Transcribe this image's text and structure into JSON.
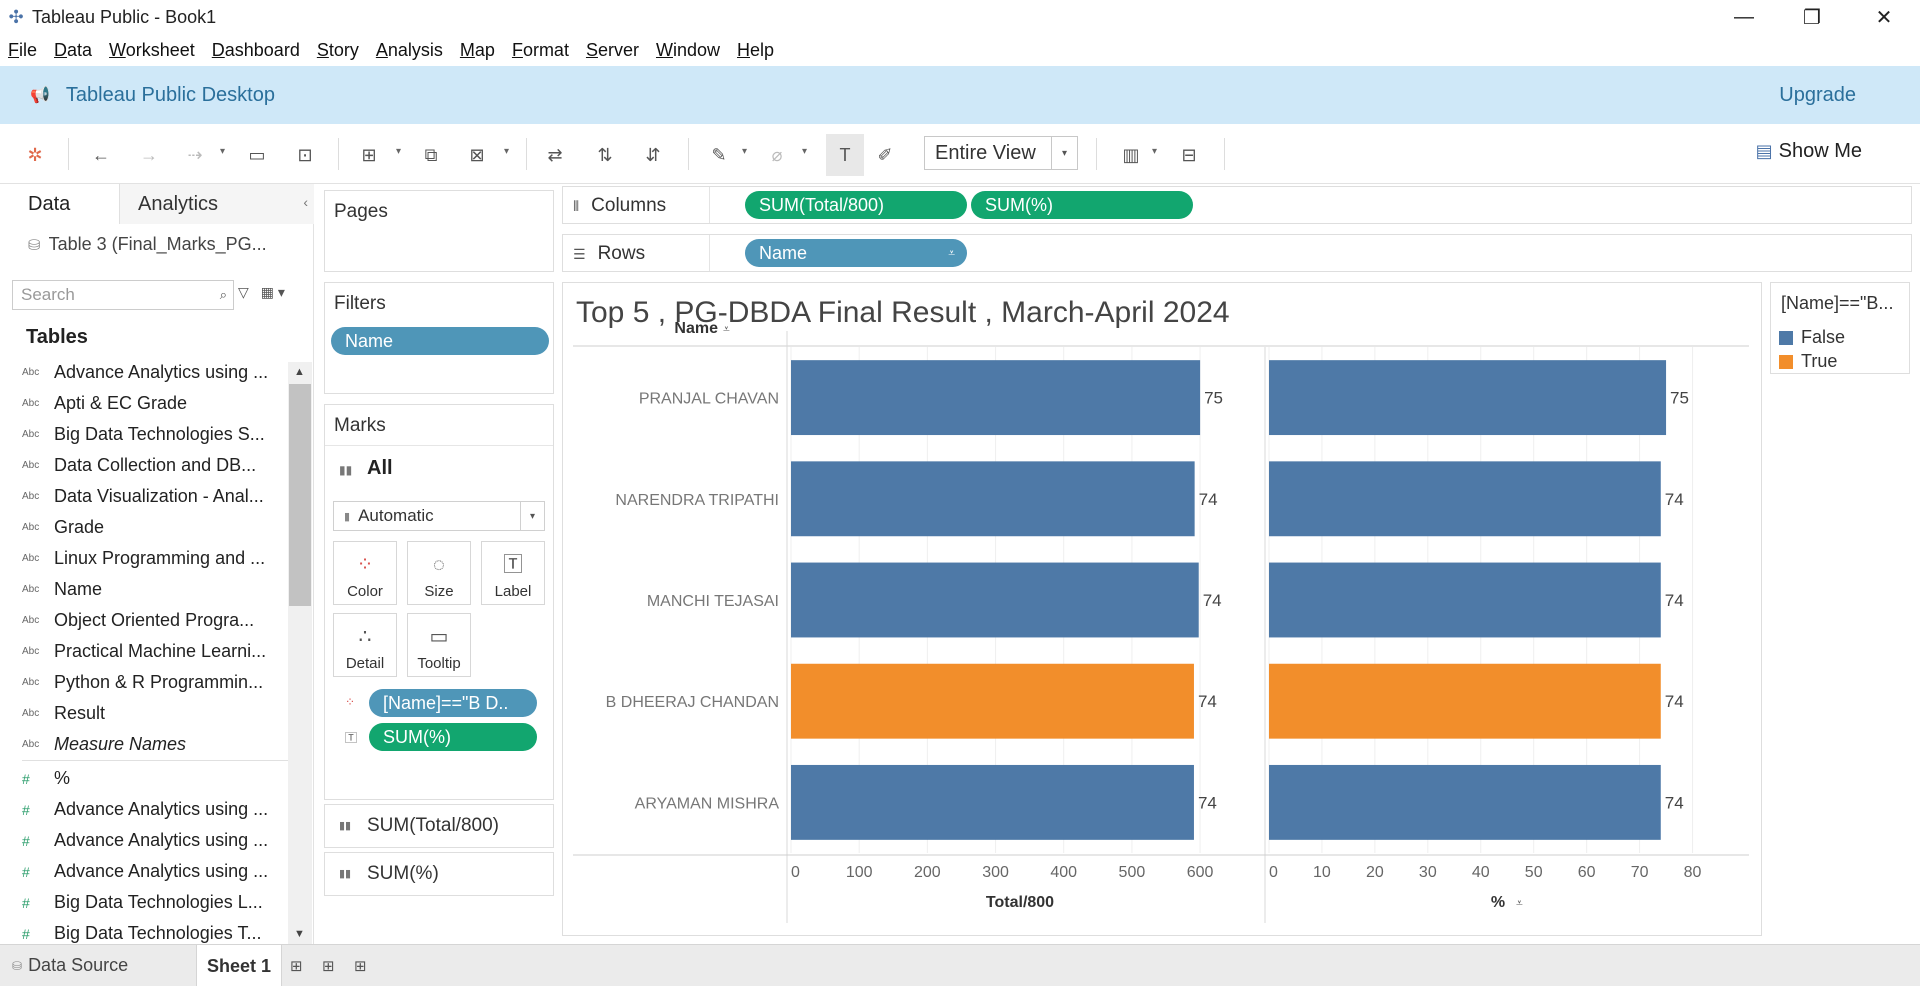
{
  "window": {
    "title": "Tableau Public - Book1"
  },
  "menu": [
    "File",
    "Data",
    "Worksheet",
    "Dashboard",
    "Story",
    "Analysis",
    "Map",
    "Format",
    "Server",
    "Window",
    "Help"
  ],
  "banner": {
    "title": "Tableau Public Desktop",
    "upgrade": "Upgrade"
  },
  "toolbar": {
    "fit": "Entire View",
    "show_me": "Show Me"
  },
  "data_pane": {
    "tab_data": "Data",
    "tab_analytics": "Analytics",
    "datasource": "Table 3 (Final_Marks_PG...",
    "search_placeholder": "Search",
    "tables_heading": "Tables",
    "dimensions": [
      "Advance Analytics using ...",
      "Apti & EC Grade",
      "Big Data Technologies S...",
      "Data Collection and DB...",
      "Data Visualization - Anal...",
      "Grade",
      "Linux Programming and ...",
      "Name",
      "Object Oriented Progra...",
      "Practical Machine Learni...",
      "Python & R Programmin...",
      "Result",
      "Measure Names"
    ],
    "measures": [
      "%",
      "Advance Analytics using ...",
      "Advance Analytics using ...",
      "Advance Analytics using ...",
      "Big Data Technologies L...",
      "Big Data Technologies T..."
    ]
  },
  "pages": {
    "title": "Pages"
  },
  "filters": {
    "title": "Filters",
    "pills": [
      "Name"
    ]
  },
  "marks": {
    "title": "Marks",
    "all_label": "All",
    "mark_type": "Automatic",
    "buttons": [
      "Color",
      "Size",
      "Label",
      "Detail",
      "Tooltip"
    ],
    "pills": [
      "[Name]==\"B D..",
      "SUM(%)"
    ],
    "sections": [
      "SUM(Total/800)",
      "SUM(%)"
    ]
  },
  "columns": {
    "label": "Columns",
    "pills": [
      "SUM(Total/800)",
      "SUM(%)"
    ]
  },
  "rows": {
    "label": "Rows",
    "pills": [
      "Name"
    ]
  },
  "legend": {
    "title": "[Name]==\"B...",
    "items": [
      {
        "label": "False",
        "color": "#4e79a7"
      },
      {
        "label": "True",
        "color": "#f28e2b"
      }
    ]
  },
  "status": {
    "data_source_tab": "Data Source",
    "sheet_tab": "Sheet 1"
  },
  "chart_data": {
    "type": "bar",
    "title": "Top 5 , PG-DBDA Final Result , March-April 2024",
    "row_header": "Name",
    "categories": [
      "PRANJAL CHAVAN",
      "NARENDRA TRIPATHI",
      "MANCHI TEJASAI",
      "B DHEERAJ CHANDAN",
      "ARYAMAN MISHRA"
    ],
    "highlight": [
      false,
      false,
      false,
      true,
      false
    ],
    "series": [
      {
        "name": "Total/800",
        "values": [
          600,
          592,
          598,
          591,
          591
        ],
        "labels": [
          "75",
          "74",
          "74",
          "74",
          "74"
        ],
        "xlim": [
          0,
          660
        ],
        "ticks": [
          0,
          100,
          200,
          300,
          400,
          500,
          600
        ],
        "xlabel": "Total/800"
      },
      {
        "name": "%",
        "values": [
          75,
          74,
          74,
          74,
          74
        ],
        "labels": [
          "75",
          "74",
          "74",
          "74",
          "74"
        ],
        "xlim": [
          0,
          85
        ],
        "ticks": [
          0,
          10,
          20,
          30,
          40,
          50,
          60,
          70,
          80
        ],
        "xlabel": "%"
      }
    ],
    "colors": {
      "false": "#4e79a7",
      "true": "#f28e2b"
    },
    "grid": true
  }
}
